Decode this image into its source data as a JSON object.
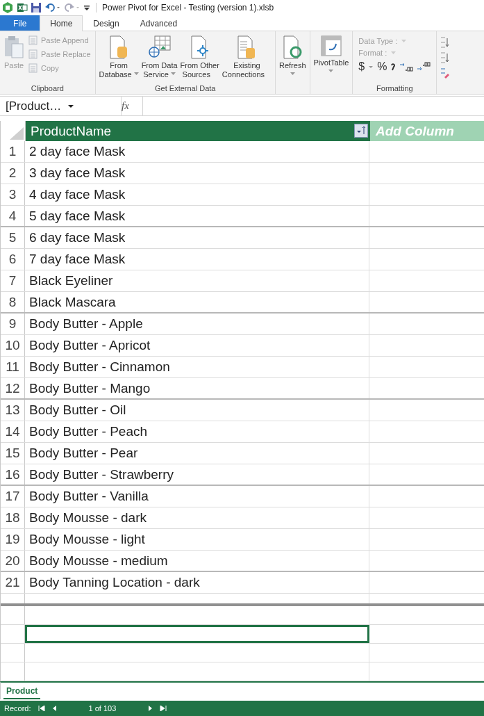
{
  "title_bar": {
    "title": "Power Pivot for Excel - Testing (version 1).xlsb"
  },
  "tabs": [
    {
      "label": "File",
      "kind": "file",
      "selected": false
    },
    {
      "label": "Home",
      "kind": "tab",
      "selected": true
    },
    {
      "label": "Design",
      "kind": "tab",
      "selected": false
    },
    {
      "label": "Advanced",
      "kind": "tab",
      "selected": false
    }
  ],
  "clipboard": {
    "label": "Clipboard",
    "paste": {
      "label": "Paste",
      "disabled": true
    },
    "items": [
      {
        "label": "Paste Append",
        "disabled": true
      },
      {
        "label": "Paste Replace",
        "disabled": true
      },
      {
        "label": "Copy",
        "disabled": true
      }
    ]
  },
  "external_data": {
    "label": "Get External Data",
    "buttons": [
      {
        "kind": "database",
        "lines": [
          "From",
          "Database"
        ],
        "dropdown": true
      },
      {
        "kind": "service",
        "lines": [
          "From Data",
          "Service"
        ],
        "dropdown": true
      },
      {
        "kind": "other",
        "lines": [
          "From Other",
          "Sources"
        ],
        "dropdown": false
      },
      {
        "kind": "existing",
        "lines": [
          "Existing",
          "Connections"
        ],
        "dropdown": false
      }
    ]
  },
  "refresh": {
    "label": "Refresh",
    "dropdown": true
  },
  "pivottable": {
    "label": "PivotTable",
    "dropdown": true
  },
  "formatting": {
    "label": "Formatting",
    "data_type": "Data Type :",
    "format": "Format :",
    "currency": "$",
    "percent": "%"
  },
  "name_box": {
    "value": "[Product…"
  },
  "formula_bar": {
    "symbol": "fx"
  },
  "table": {
    "column": "ProductName",
    "add_column": "Add Column",
    "rows": [
      {
        "n": "1",
        "name": "2 day face Mask"
      },
      {
        "n": "2",
        "name": "3 day face Mask"
      },
      {
        "n": "3",
        "name": "4 day face Mask"
      },
      {
        "n": "4",
        "name": "5 day face Mask"
      },
      {
        "n": "5",
        "name": "6 day face Mask"
      },
      {
        "n": "6",
        "name": "7 day face Mask"
      },
      {
        "n": "7",
        "name": "Black Eyeliner"
      },
      {
        "n": "8",
        "name": "Black Mascara"
      },
      {
        "n": "9",
        "name": "Body Butter - Apple"
      },
      {
        "n": "10",
        "name": "Body Butter - Apricot"
      },
      {
        "n": "11",
        "name": "Body Butter - Cinnamon"
      },
      {
        "n": "12",
        "name": "Body Butter - Mango"
      },
      {
        "n": "13",
        "name": "Body Butter - Oil"
      },
      {
        "n": "14",
        "name": "Body Butter - Peach"
      },
      {
        "n": "15",
        "name": "Body Butter - Pear"
      },
      {
        "n": "16",
        "name": "Body Butter - Strawberry"
      },
      {
        "n": "17",
        "name": "Body Butter - Vanilla"
      },
      {
        "n": "18",
        "name": "Body Mousse - dark"
      },
      {
        "n": "19",
        "name": "Body Mousse - light"
      },
      {
        "n": "20",
        "name": "Body Mousse - medium"
      },
      {
        "n": "21",
        "name": "Body Tanning Location - dark"
      }
    ]
  },
  "calc_area": {
    "rows": [
      {
        "selected": false
      },
      {
        "selected": true
      },
      {
        "selected": false
      },
      {
        "selected": false
      }
    ]
  },
  "sheet_tabs": [
    {
      "label": "Product",
      "selected": true
    }
  ],
  "status_bar": {
    "record_label": "Record:",
    "position": "1 of 103"
  }
}
